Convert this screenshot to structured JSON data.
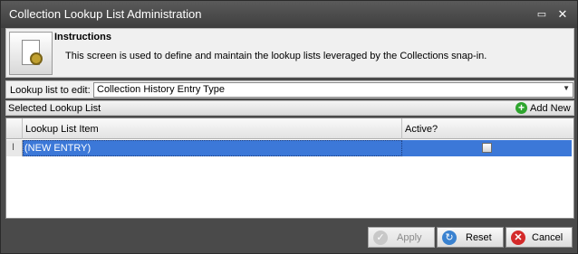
{
  "window": {
    "title": "Collection Lookup List Administration",
    "maximize_glyph": "▭",
    "close_glyph": "✕"
  },
  "instructions": {
    "title": "Instructions",
    "description": "This screen is used to define and maintain the lookup lists leveraged by the Collections snap-in.",
    "icon": "document-gear-icon"
  },
  "lookup": {
    "label": "Lookup list to edit:",
    "selected": "Collection History Entry Type",
    "arrow": "▼"
  },
  "section": {
    "label": "Selected Lookup List",
    "add_new_label": "Add New",
    "add_new_glyph": "+"
  },
  "grid": {
    "columns": [
      "Lookup List Item",
      "Active?"
    ],
    "rows": [
      {
        "item": "(NEW ENTRY)",
        "active": false,
        "indicator": "I"
      }
    ]
  },
  "buttons": {
    "apply": {
      "label": "Apply",
      "enabled": false,
      "glyph": "✓"
    },
    "reset": {
      "label": "Reset",
      "glyph": "↻"
    },
    "cancel": {
      "label": "Cancel",
      "glyph": "✕"
    }
  },
  "colors": {
    "selection": "#3c78d8",
    "add_icon": "#2ea52e",
    "cancel_icon": "#d42a2a",
    "reset_icon": "#3a82d0"
  }
}
